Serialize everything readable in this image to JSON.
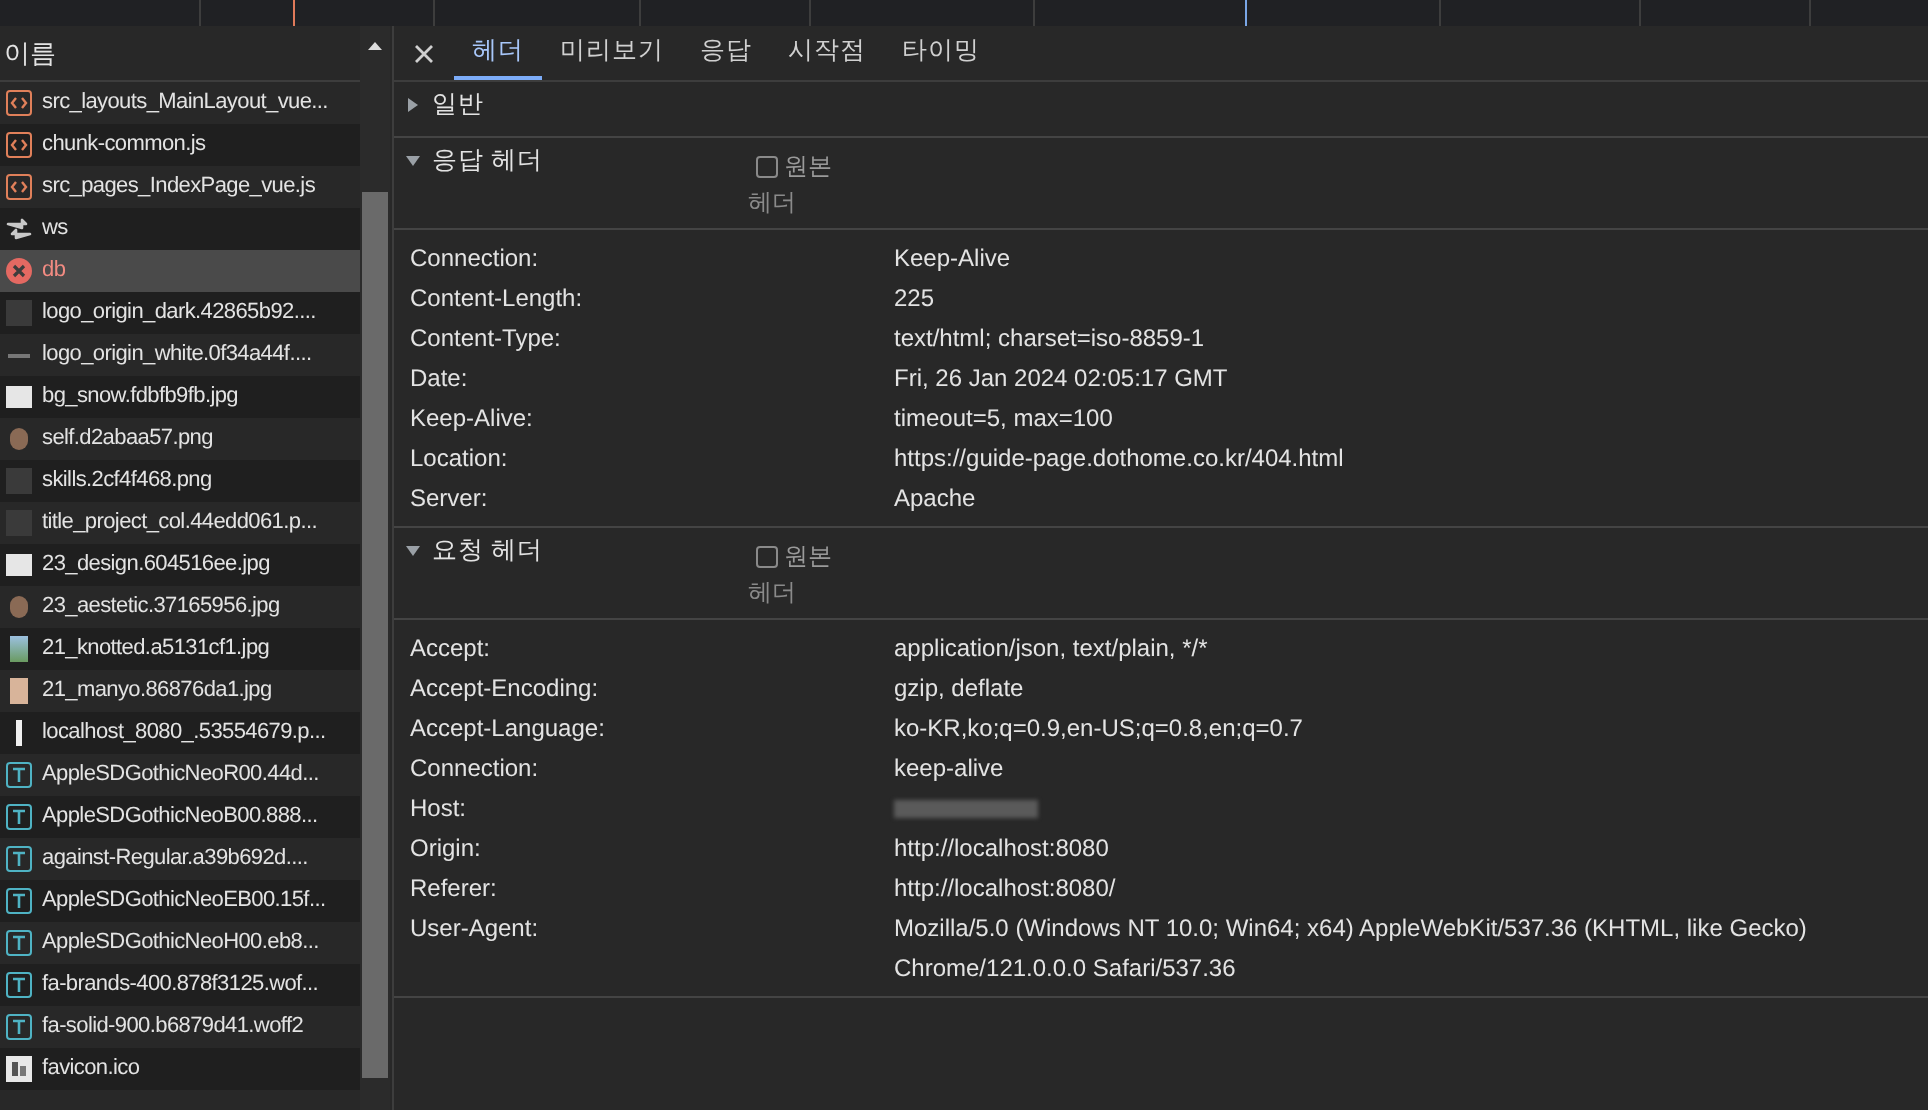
{
  "requests": {
    "column_header": "이름",
    "items": [
      {
        "name": "src_layouts_MainLayout_vue...",
        "kind": "script",
        "selected": false
      },
      {
        "name": "chunk-common.js",
        "kind": "script",
        "selected": false
      },
      {
        "name": "src_pages_IndexPage_vue.js",
        "kind": "script",
        "selected": false
      },
      {
        "name": "ws",
        "kind": "websocket",
        "selected": false
      },
      {
        "name": "db",
        "kind": "error",
        "selected": true
      },
      {
        "name": "logo_origin_dark.42865b92....",
        "kind": "image-dark",
        "selected": false
      },
      {
        "name": "logo_origin_white.0f34a44f....",
        "kind": "image-line",
        "selected": false
      },
      {
        "name": "bg_snow.fdbfb9fb.jpg",
        "kind": "image-light",
        "selected": false
      },
      {
        "name": "self.d2abaa57.png",
        "kind": "image-round",
        "selected": false
      },
      {
        "name": "skills.2cf4f468.png",
        "kind": "image-dark",
        "selected": false
      },
      {
        "name": "title_project_col.44edd061.p...",
        "kind": "image-dark",
        "selected": false
      },
      {
        "name": "23_design.604516ee.jpg",
        "kind": "image-light",
        "selected": false
      },
      {
        "name": "23_aestetic.37165956.jpg",
        "kind": "image-round",
        "selected": false
      },
      {
        "name": "21_knotted.a5131cf1.jpg",
        "kind": "image-blue",
        "selected": false
      },
      {
        "name": "21_manyo.86876da1.jpg",
        "kind": "image-beige",
        "selected": false
      },
      {
        "name": "localhost_8080_.53554679.p...",
        "kind": "image-bar",
        "selected": false
      },
      {
        "name": "AppleSDGothicNeoR00.44d...",
        "kind": "font",
        "selected": false
      },
      {
        "name": "AppleSDGothicNeoB00.888...",
        "kind": "font",
        "selected": false
      },
      {
        "name": "against-Regular.a39b692d....",
        "kind": "font",
        "selected": false
      },
      {
        "name": "AppleSDGothicNeoEB00.15f...",
        "kind": "font",
        "selected": false
      },
      {
        "name": "AppleSDGothicNeoH00.eb8...",
        "kind": "font",
        "selected": false
      },
      {
        "name": "fa-brands-400.878f3125.wof...",
        "kind": "font",
        "selected": false
      },
      {
        "name": "fa-solid-900.b6879d41.woff2",
        "kind": "font",
        "selected": false
      },
      {
        "name": "favicon.ico",
        "kind": "favicon",
        "selected": false
      }
    ]
  },
  "tabs": [
    {
      "label": "헤더",
      "selected": true
    },
    {
      "label": "미리보기",
      "selected": false
    },
    {
      "label": "응답",
      "selected": false
    },
    {
      "label": "시작점",
      "selected": false
    },
    {
      "label": "타이밍",
      "selected": false
    }
  ],
  "sections": [
    {
      "title": "일반",
      "expanded": false
    },
    {
      "title": "응답 헤더",
      "expanded": true,
      "raw_label": "원본",
      "raw_checked": false,
      "column_label": "헤더",
      "headers": [
        {
          "name": "Connection:",
          "value": "Keep-Alive"
        },
        {
          "name": "Content-Length:",
          "value": "225"
        },
        {
          "name": "Content-Type:",
          "value": "text/html; charset=iso-8859-1"
        },
        {
          "name": "Date:",
          "value": "Fri, 26 Jan 2024 02:05:17 GMT"
        },
        {
          "name": "Keep-Alive:",
          "value": "timeout=5, max=100"
        },
        {
          "name": "Location:",
          "value": "https://guide-page.dothome.co.kr/404.html"
        },
        {
          "name": "Server:",
          "value": "Apache"
        }
      ]
    },
    {
      "title": "요청 헤더",
      "expanded": true,
      "raw_label": "원본",
      "raw_checked": false,
      "column_label": "헤더",
      "headers": [
        {
          "name": "Accept:",
          "value": "application/json, text/plain, */*"
        },
        {
          "name": "Accept-Encoding:",
          "value": "gzip, deflate"
        },
        {
          "name": "Accept-Language:",
          "value": "ko-KR,ko;q=0.9,en-US;q=0.8,en;q=0.7"
        },
        {
          "name": "Connection:",
          "value": "keep-alive"
        },
        {
          "name": "Host:",
          "blurred": true
        },
        {
          "name": "Origin:",
          "value": "http://localhost:8080"
        },
        {
          "name": "Referer:",
          "value": "http://localhost:8080/"
        },
        {
          "name": "User-Agent:",
          "value": "Mozilla/5.0 (Windows NT 10.0; Win64; x64) AppleWebKit/537.36 (KHTML, like Gecko) Chrome/121.0.0.0 Safari/537.36"
        }
      ]
    }
  ]
}
